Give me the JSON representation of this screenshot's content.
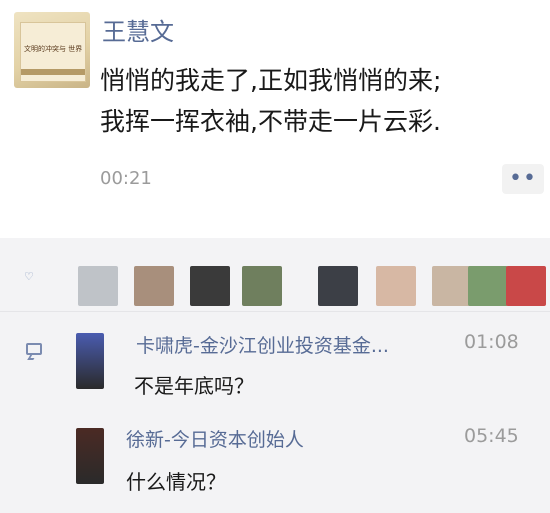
{
  "moment": {
    "author_name": "王慧文",
    "book_cover_text": "文明的冲突与 世界秩序的重建",
    "text_line1": "悄悄的我走了,正如我悄悄的来;",
    "text_line2": "我挥一挥衣袖,不带走一片云彩.",
    "time": "00:21",
    "more_icon": "••"
  },
  "likes": {
    "heart_icon": "heart-icon",
    "heart_glyph": "♡",
    "avatars": [
      {
        "color": "#bfc3c8"
      },
      {
        "color": "#a88f7c"
      },
      {
        "color": "#3a3a3a"
      },
      {
        "color": "#6f7f5e"
      },
      {
        "color": "#3c3f46"
      },
      {
        "color": "#d7b8a4"
      },
      {
        "color": "#c9b6a3"
      },
      {
        "color": "#7a9c6d"
      },
      {
        "color": "#c94848"
      }
    ]
  },
  "comments": [
    {
      "name": "卡啸虎-金沙江创业投资基金...",
      "time": "01:08",
      "text": "不是年底吗？",
      "avatar_color": "#4a5cb0"
    },
    {
      "name": "徐新-今日资本创始人",
      "time": "05:45",
      "text": "什么情况？",
      "avatar_color": "#4b2a24"
    }
  ],
  "colors": {
    "link_blue": "#576b95",
    "time_gray": "#9b9b9b",
    "panel_bg": "#f3f3f5"
  }
}
